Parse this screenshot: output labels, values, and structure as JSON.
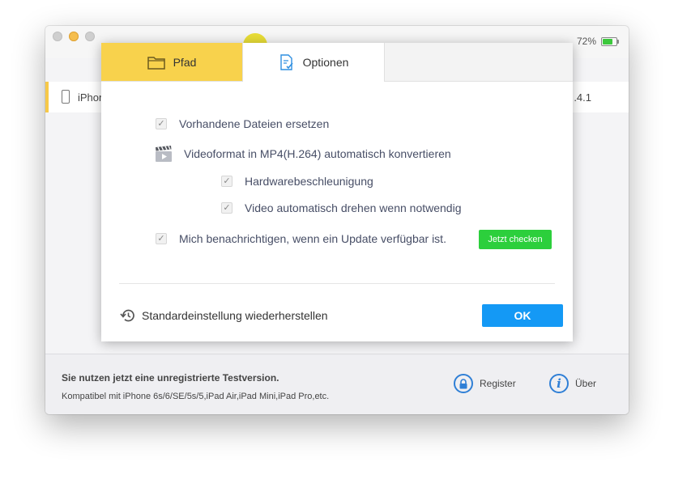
{
  "window": {
    "battery_percent": "72%",
    "battery_level": 0.72,
    "device_name": "iPhone",
    "device_version": ".4.1"
  },
  "dialog": {
    "tabs": [
      {
        "label": "Pfad",
        "icon": "folder-icon",
        "active": false
      },
      {
        "label": "Optionen",
        "icon": "options-document-icon",
        "active": true
      }
    ],
    "options": {
      "replace_files": {
        "label": "Vorhandene Dateien ersetzen",
        "checked": true
      },
      "video_convert": {
        "label": "Videoformat in MP4(H.264) automatisch konvertieren",
        "icon": "clapperboard-icon"
      },
      "hardware_accel": {
        "label": "Hardwarebeschleunigung",
        "checked": true
      },
      "auto_rotate": {
        "label": "Video automatisch drehen wenn notwendig",
        "checked": true
      },
      "notify_update": {
        "label": "Mich benachrichtigen, wenn ein Update verfügbar ist.",
        "checked": true
      }
    },
    "check_now_label": "Jetzt checken",
    "restore_label": "Standardeinstellung wiederherstellen",
    "ok_label": "OK"
  },
  "footer": {
    "notice": "Sie nutzen jetzt eine unregistrierte Testversion.",
    "compat": "Kompatibel mit iPhone 6s/6/SE/5s/5,iPad Air,iPad Mini,iPad Pro,etc.",
    "register_label": "Register",
    "about_label": "Über"
  },
  "colors": {
    "active_tab_yellow": "#f8d24c",
    "ok_blue": "#1499f5",
    "check_green": "#2ccf3c",
    "icon_blue": "#2f7fd6"
  }
}
